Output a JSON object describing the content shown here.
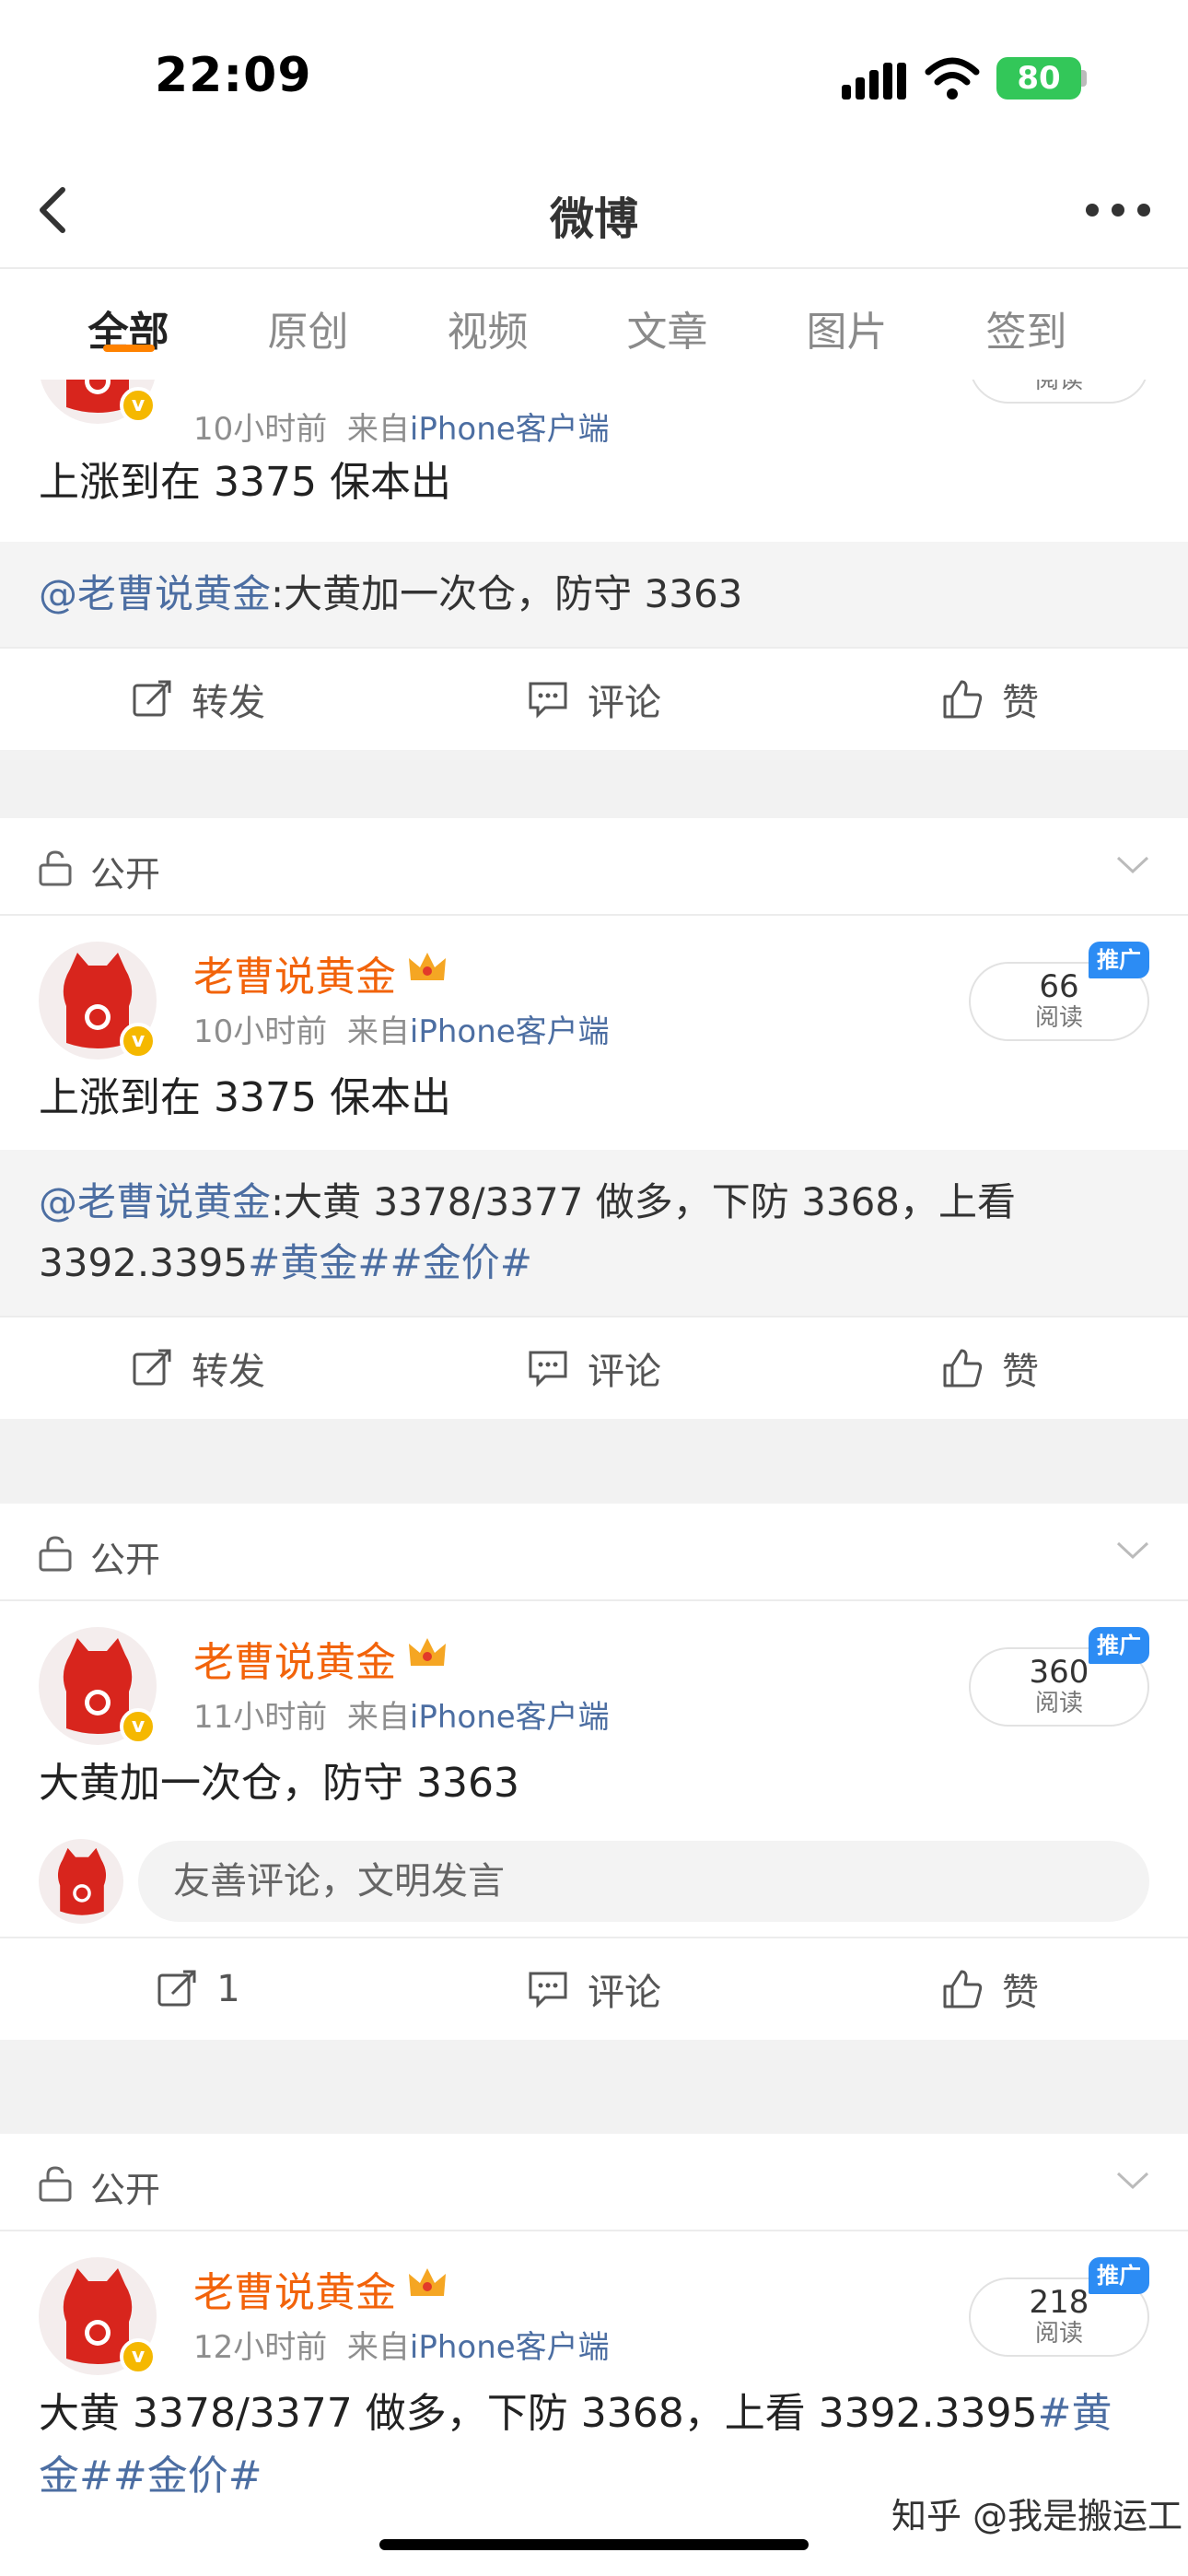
{
  "status": {
    "time": "22:09",
    "battery": "80"
  },
  "nav": {
    "title": "微博"
  },
  "tabs": [
    "全部",
    "原创",
    "视频",
    "文章",
    "图片",
    "签到"
  ],
  "common": {
    "public_label": "公开",
    "repost": "转发",
    "comment": "评论",
    "like": "赞",
    "reads_label": "阅读",
    "promo": "推广",
    "username": "老曹说黄金",
    "source_prefix": "来自",
    "source": "iPhone客户端",
    "comment_placeholder": "友善评论，文明发言"
  },
  "posts": [
    {
      "time": "10小时前",
      "text": "上涨到在 3375 保本出",
      "repost_mention": "@老曹说黄金",
      "repost_text": ":大黄加一次仓，防守 3363",
      "repost_tags": ""
    },
    {
      "time": "10小时前",
      "reads": "66",
      "text": "上涨到在 3375 保本出",
      "repost_mention": "@老曹说黄金",
      "repost_text": ":大黄 3378/3377 做多，下防 3368，上看 3392.3395",
      "repost_tags": "#黄金##金价#"
    },
    {
      "time": "11小时前",
      "reads": "360",
      "text": "大黄加一次仓，防守 3363",
      "repost_count": "1"
    },
    {
      "time": "12小时前",
      "reads": "218",
      "text": "大黄 3378/3377 做多，下防 3368，上看 3392.3395",
      "tags": "#黄金##金价#"
    }
  ],
  "watermark": "知乎 @我是搬运工"
}
